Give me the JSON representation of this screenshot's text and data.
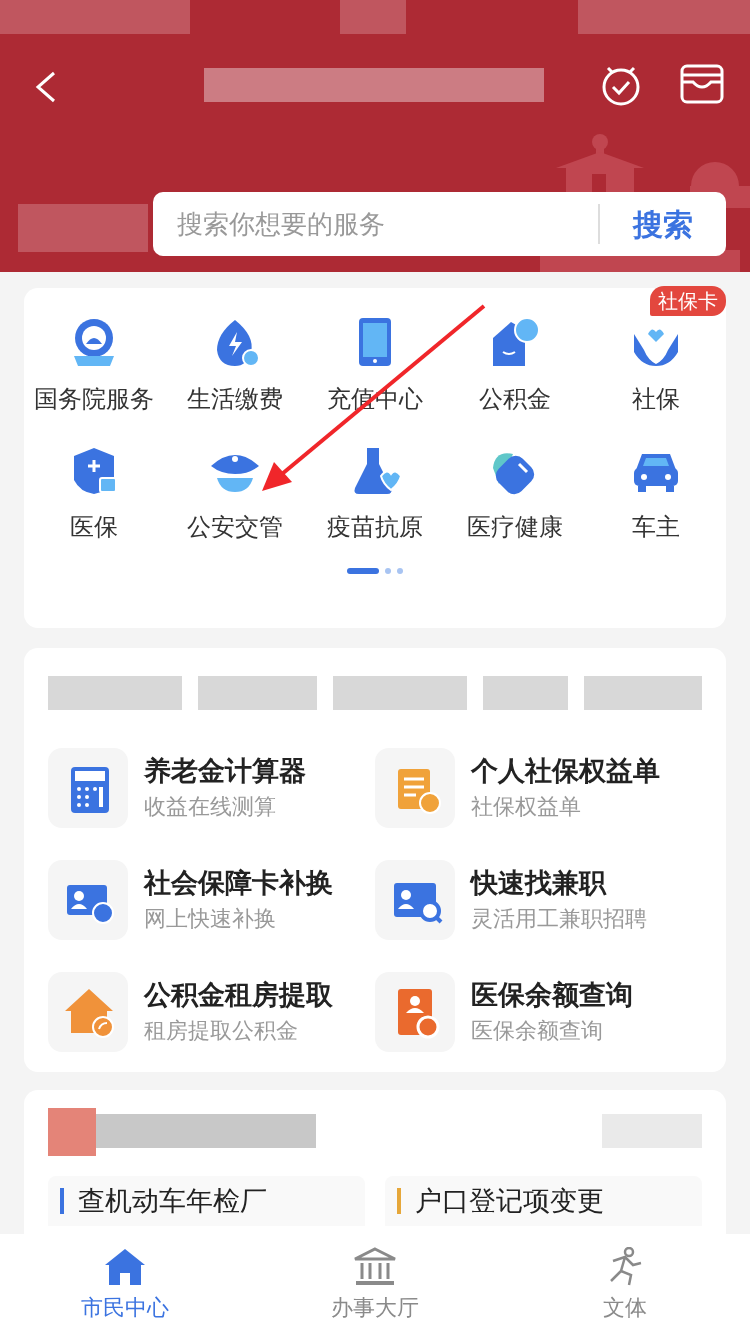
{
  "header": {
    "search": {
      "placeholder": "搜索你想要的服务",
      "button": "搜索"
    }
  },
  "services": [
    {
      "label": "国务院服务"
    },
    {
      "label": "生活缴费"
    },
    {
      "label": "充值中心"
    },
    {
      "label": "公积金"
    },
    {
      "label": "社保",
      "badge": "社保卡"
    },
    {
      "label": "医保"
    },
    {
      "label": "公安交管"
    },
    {
      "label": "疫苗抗原"
    },
    {
      "label": "医疗健康"
    },
    {
      "label": "车主"
    }
  ],
  "page_dots": [
    {
      "selected": true
    },
    {
      "selected": false
    },
    {
      "selected": false
    }
  ],
  "quick_links": [
    {
      "title": "养老金计算器",
      "subtitle": "收益在线测算"
    },
    {
      "title": "个人社保权益单",
      "subtitle": "社保权益单"
    },
    {
      "title": "社会保障卡补换",
      "subtitle": "网上快速补换"
    },
    {
      "title": "快速找兼职",
      "subtitle": "灵活用工兼职招聘"
    },
    {
      "title": "公积金租房提取",
      "subtitle": "租房提取公积金"
    },
    {
      "title": "医保余额查询",
      "subtitle": "医保余额查询"
    }
  ],
  "topics": [
    {
      "label": "查机动车年检厂",
      "color": "#3b73e0"
    },
    {
      "label": "户口登记项变更",
      "color": "#e6a73a"
    }
  ],
  "bottom_nav": [
    {
      "label": "市民中心",
      "selected": true
    },
    {
      "label": "办事大厅",
      "selected": false
    },
    {
      "label": "文体",
      "selected": false
    }
  ]
}
